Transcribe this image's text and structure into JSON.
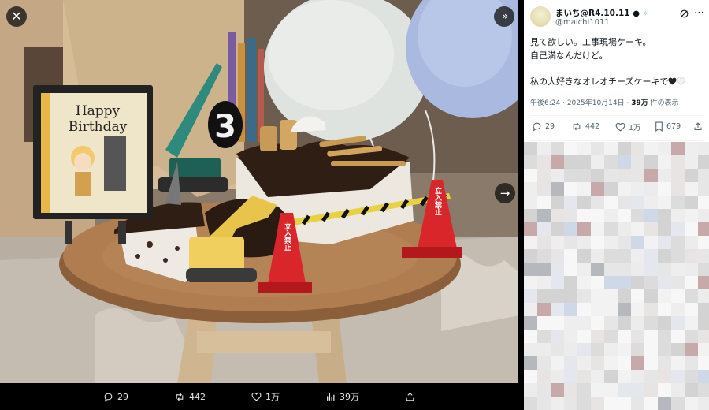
{
  "viewer": {
    "buttons": {
      "close": "✕",
      "collapse": "»",
      "next": "→"
    },
    "sign": {
      "line1": "Happy",
      "line2": "Birthday"
    },
    "candle_number": "3",
    "cone_text": "立入禁止",
    "actions": [
      {
        "name": "reply",
        "icon": "reply-icon",
        "count": "29"
      },
      {
        "name": "repost",
        "icon": "repost-icon",
        "count": "442"
      },
      {
        "name": "like",
        "icon": "heart-icon",
        "count": "1万"
      },
      {
        "name": "views",
        "icon": "chart-icon",
        "count": "39万"
      },
      {
        "name": "share",
        "icon": "share-icon",
        "count": ""
      }
    ]
  },
  "tweet": {
    "display_name": "まいち@R4.10.11",
    "handle": "@maichi1011",
    "lines": [
      "見て欲しい。工事現場ケーキ。",
      "自己満なんだけど。",
      "",
      "私の大好きなオレオチーズケーキで"
    ],
    "time": "午後6:24",
    "date": "2025年10月14日",
    "views": "39万",
    "views_suffix": " 件の表示",
    "stats": {
      "replies": "29",
      "reposts": "442",
      "likes": "1万",
      "bookmarks": "679"
    }
  },
  "colors": {
    "accent": "#1d9bf0",
    "text": "#0f1419",
    "muted": "#536471",
    "cone": "#d9262b"
  }
}
